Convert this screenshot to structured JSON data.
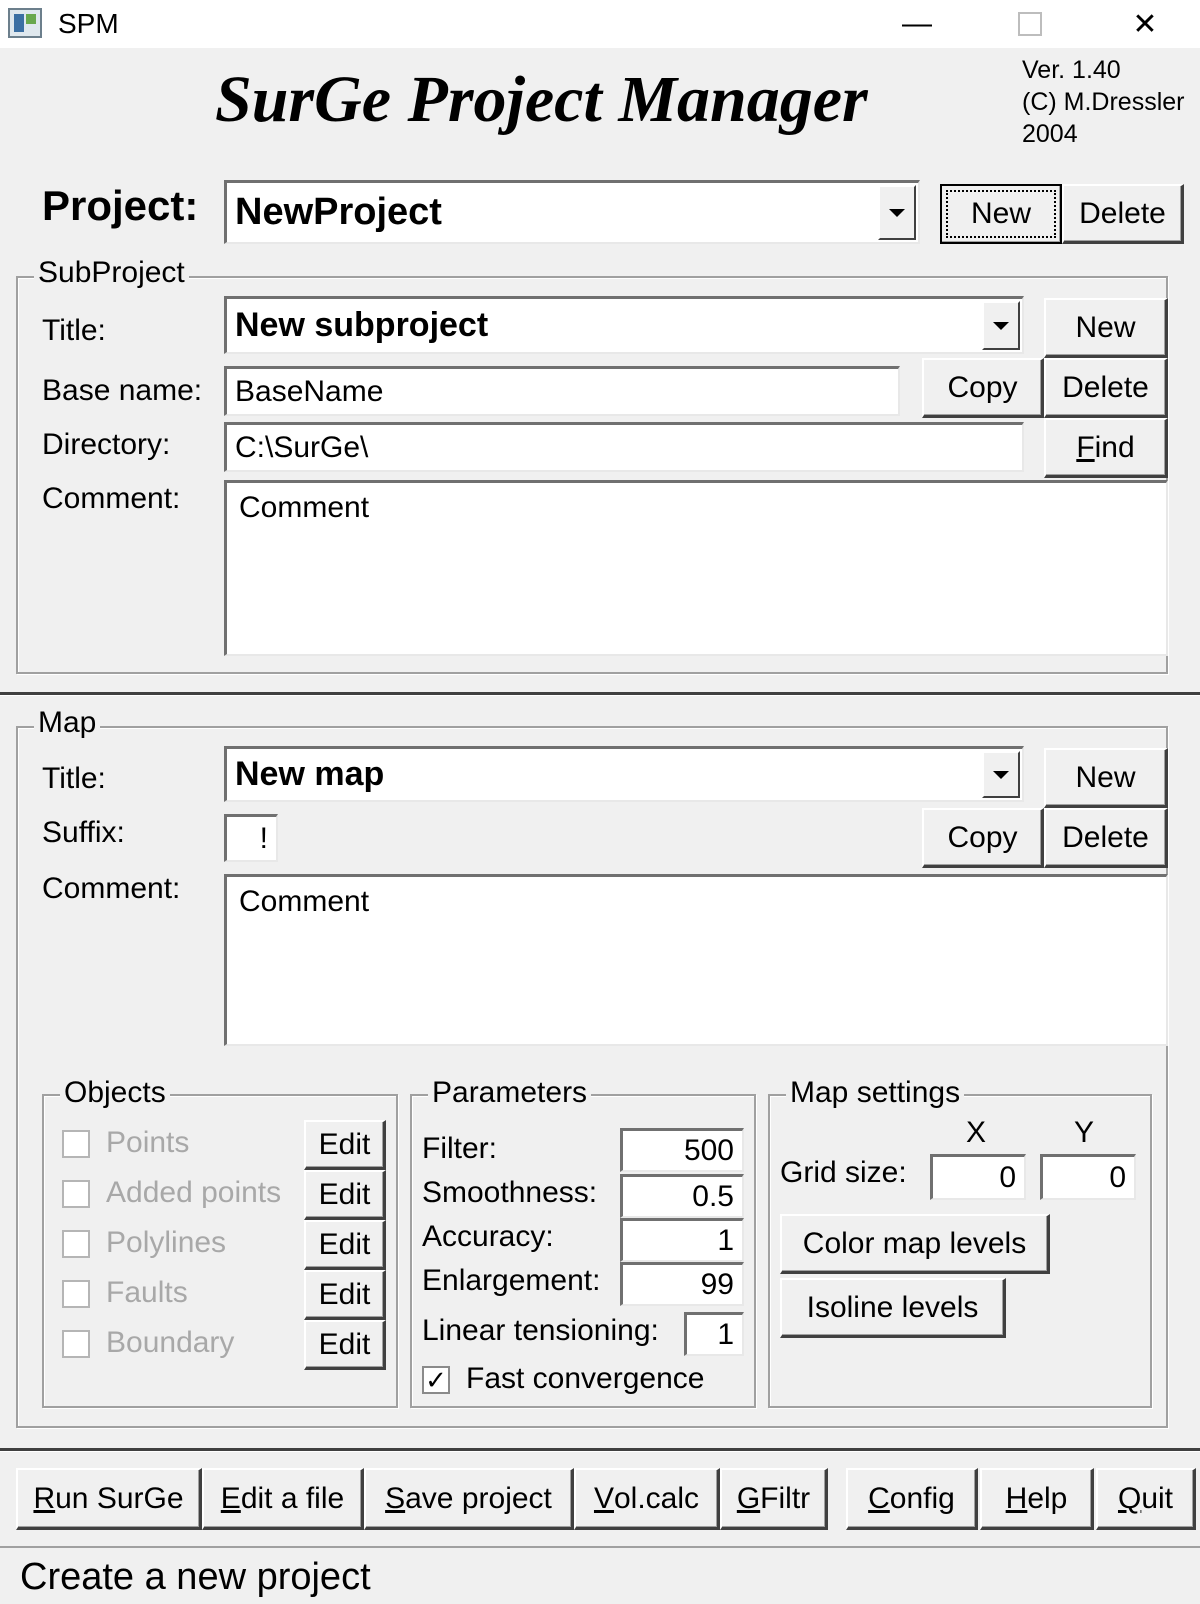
{
  "window": {
    "title": "SPM",
    "minimize_glyph": "—",
    "close_glyph": "✕"
  },
  "banner": {
    "title": "SurGe Project Manager",
    "version": "Ver. 1.40",
    "copyright": "(C) M.Dressler",
    "year": "2004"
  },
  "project": {
    "label": "Project:",
    "value": "NewProject",
    "new_label": "New",
    "delete_label": "Delete"
  },
  "subproject": {
    "group_title": "SubProject",
    "title_label": "Title:",
    "title_value": "New subproject",
    "new_label": "New",
    "base_name_label": "Base name:",
    "base_name_value": "BaseName",
    "copy_label": "Copy",
    "delete_label": "Delete",
    "directory_label": "Directory:",
    "directory_value": "C:\\SurGe\\",
    "find_label": "Find",
    "comment_label": "Comment:",
    "comment_value": "Comment"
  },
  "map": {
    "group_title": "Map",
    "title_label": "Title:",
    "title_value": "New map",
    "new_label": "New",
    "suffix_label": "Suffix:",
    "suffix_value": "!",
    "copy_label": "Copy",
    "delete_label": "Delete",
    "comment_label": "Comment:",
    "comment_value": "Comment"
  },
  "objects": {
    "group_title": "Objects",
    "edit_label": "Edit",
    "items": [
      {
        "label": "Points",
        "checked": false
      },
      {
        "label": "Added points",
        "checked": false
      },
      {
        "label": "Polylines",
        "checked": false
      },
      {
        "label": "Faults",
        "checked": false
      },
      {
        "label": "Boundary",
        "checked": false
      }
    ]
  },
  "parameters": {
    "group_title": "Parameters",
    "filter_label": "Filter:",
    "filter_value": "500",
    "smoothness_label": "Smoothness:",
    "smoothness_value": "0.5",
    "accuracy_label": "Accuracy:",
    "accuracy_value": "1",
    "enlargement_label": "Enlargement:",
    "enlargement_value": "99",
    "linear_label": "Linear tensioning:",
    "linear_value": "1",
    "fast_label": "Fast convergence",
    "fast_checked": true,
    "check_glyph": "✓"
  },
  "map_settings": {
    "group_title": "Map settings",
    "x_label": "X",
    "y_label": "Y",
    "grid_label": "Grid size:",
    "grid_x": "0",
    "grid_y": "0",
    "color_levels_label": "Color map levels",
    "isoline_levels_label": "Isoline levels"
  },
  "toolbar": {
    "run": {
      "ul": "R",
      "rest": "un SurGe"
    },
    "edit": {
      "ul": "E",
      "rest": "dit a file"
    },
    "save": {
      "ul": "S",
      "rest": "ave project"
    },
    "vol": {
      "ul": "V",
      "rest": "ol.calc"
    },
    "gfiltr": {
      "ul": "G",
      "rest": "Filtr"
    },
    "config": {
      "ul": "C",
      "rest": "onfig"
    },
    "help": {
      "ul": "H",
      "rest": "elp"
    },
    "quit": {
      "ul": "Q",
      "rest": "uit"
    }
  },
  "find_ul": {
    "ul": "F",
    "rest": "ind"
  },
  "status": {
    "text": "Create a new project"
  }
}
